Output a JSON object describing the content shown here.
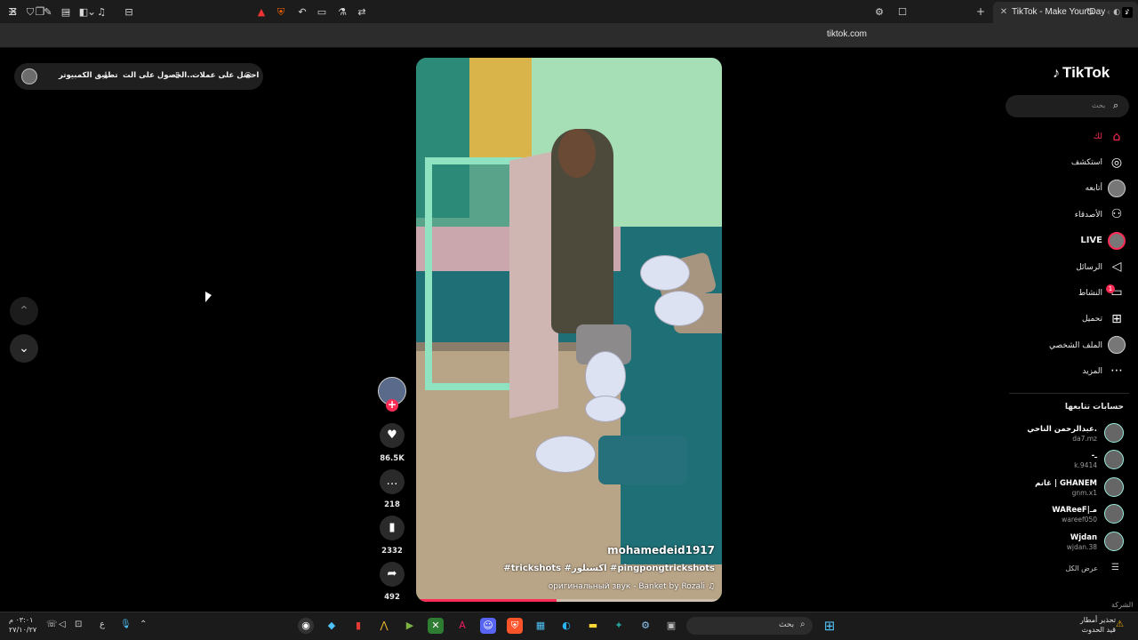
{
  "browser": {
    "tab_title": "TikTok - Make Your Day",
    "url": "tiktok.com"
  },
  "top_links": {
    "coins": "احصل على عملات",
    "get_app": "الحصول على الت...",
    "desktop_app": "تطبيق الكمبيوتر"
  },
  "video": {
    "username": "mohamedeid1917",
    "tags": "#trickshots #اكسبلور #pingpongtrickshots",
    "music": "оригинальный звук - Banket by Rozali",
    "progress": 0.46
  },
  "actions": {
    "likes": "86.5K",
    "comments": "218",
    "saves": "2332",
    "shares": "492"
  },
  "sidebar": {
    "logo": "TikTok",
    "search_placeholder": "بحث",
    "items": [
      {
        "label": "لك"
      },
      {
        "label": "استكشف"
      },
      {
        "label": "أتابعه"
      },
      {
        "label": "الأصدقاء"
      },
      {
        "label": "LIVE"
      },
      {
        "label": "الرسائل"
      },
      {
        "label": "النشاط",
        "badge": "1"
      },
      {
        "label": "تحميل"
      },
      {
        "label": "الملف الشخصي"
      },
      {
        "label": "المزيد"
      }
    ],
    "following_header": "حسابات تتابعها",
    "accounts": [
      {
        "name": "عبدالرحمن الناحي.",
        "handle": "da7.mz"
      },
      {
        "name": "-ـ",
        "handle": "k.9414"
      },
      {
        "name": "غانم | GHANEM",
        "handle": "gnm.x1"
      },
      {
        "name": "WAReeF|مـ",
        "handle": "wareef050"
      },
      {
        "name": "Wjdan",
        "handle": "wjdan.38"
      }
    ],
    "see_all": "عرض الكل",
    "company": "الشركة"
  },
  "taskbar": {
    "search": "بحث",
    "weather_line1": "تحذير أمطار",
    "weather_line2": "قيد الحدوث",
    "time": "٠٣:٠١ م",
    "date": "٢٧/١٠/٢٧",
    "lang": "ع"
  },
  "colors": {
    "accent": "#fe2c55",
    "background": "#000000"
  }
}
